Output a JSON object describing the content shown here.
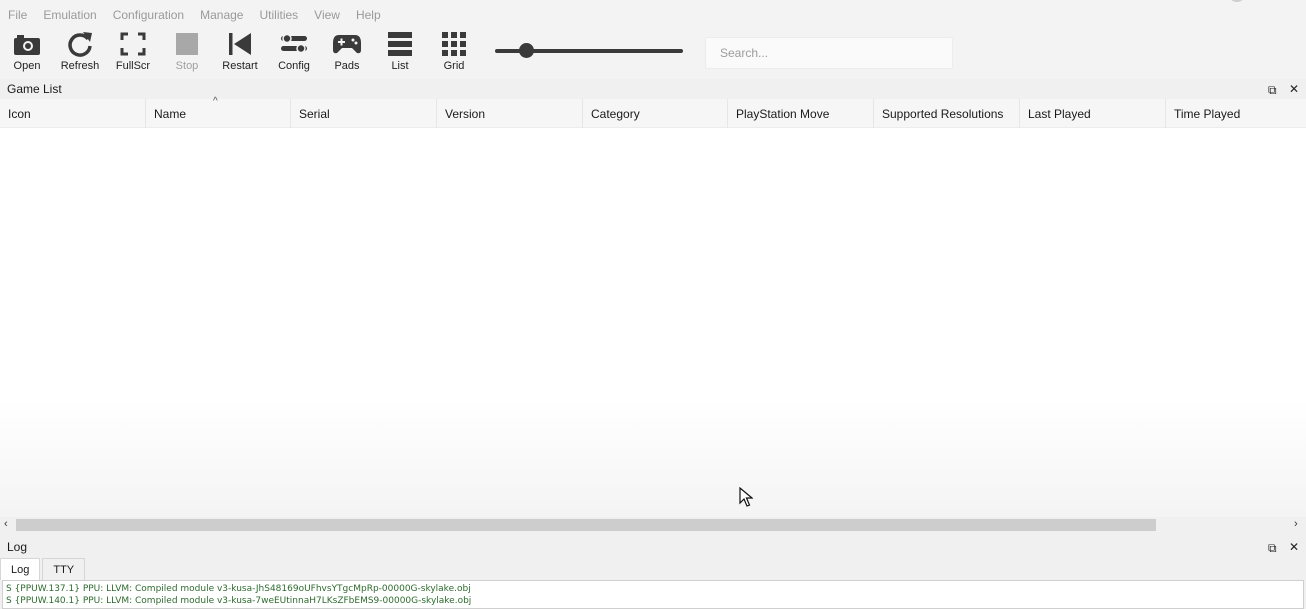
{
  "menu": [
    "File",
    "Emulation",
    "Configuration",
    "Manage",
    "Utilities",
    "View",
    "Help"
  ],
  "toolbar": {
    "open": "Open",
    "refresh": "Refresh",
    "fullscr": "FullScr",
    "stop": "Stop",
    "restart": "Restart",
    "config": "Config",
    "pads": "Pads",
    "list": "List",
    "grid": "Grid"
  },
  "zoom_slider": {
    "value_fraction": 0.17
  },
  "search": {
    "placeholder": "Search..."
  },
  "game_list": {
    "title": "Game List",
    "columns": [
      "Icon",
      "Name",
      "Serial",
      "Version",
      "Category",
      "PlayStation Move",
      "Supported Resolutions",
      "Last Played",
      "Time Played"
    ],
    "sort_indicator": "^"
  },
  "log_panel": {
    "title": "Log",
    "tabs": [
      "Log",
      "TTY"
    ],
    "lines": [
      "S {PPUW.137.1} PPU: LLVM: Compiled module v3-kusa-JhS48169oUFhvsYTgcMpRp-00000G-skylake.obj",
      "S {PPUW.140.1} PPU: LLVM: Compiled module v3-kusa-7weEUtinnaH7LKsZFbEMS9-00000G-skylake.obj"
    ]
  },
  "colors": {
    "log_text": "#2e6b2e",
    "icon": "#3a3a3a"
  }
}
